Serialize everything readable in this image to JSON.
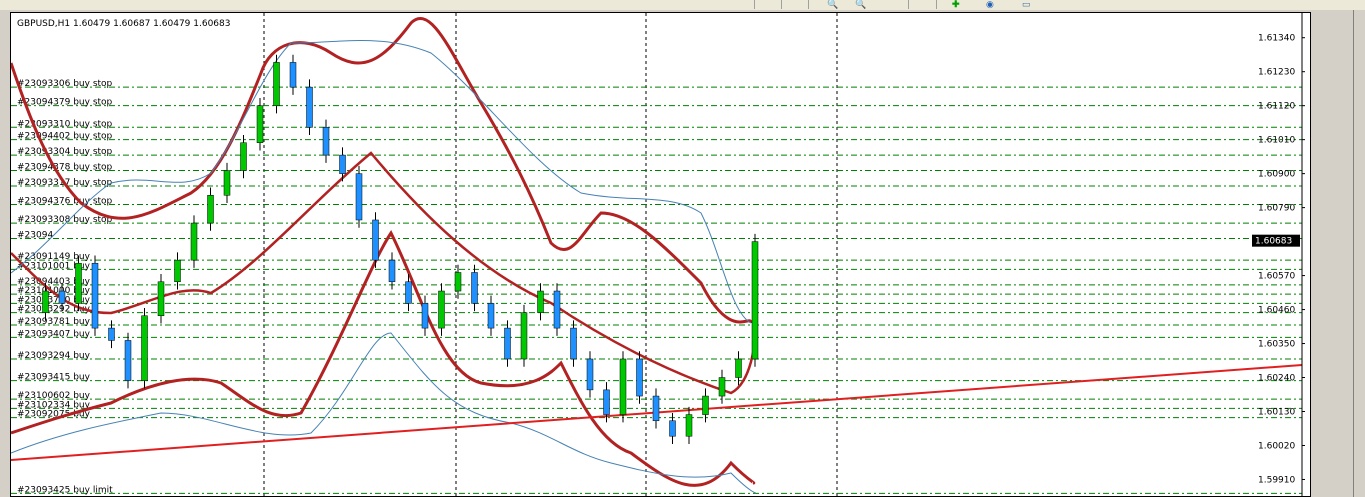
{
  "window": {
    "symbol_header": "GBPUSD,H1  1.60479 1.60687 1.60479 1.60683",
    "current_price": "1.60683"
  },
  "toolbar": {
    "icons": [
      "period-icon",
      "period-icon",
      "period-icon",
      "zoom-in-icon",
      "zoom-out-icon",
      "chart-shift-icon",
      "autoscroll-icon",
      "add-indicator-icon",
      "periodicity-icon",
      "template-icon"
    ]
  },
  "colors": {
    "buy": "#008000",
    "sell_bear": "#1e90ff",
    "band": "#b22222",
    "band_thin": "#4682b4",
    "trend": "#e02020",
    "grid": "#000000"
  },
  "price_axis": {
    "min": 1.5985,
    "max": 1.6142,
    "ticks": [
      "1.61340",
      "1.61230",
      "1.61120",
      "1.61010",
      "1.60900",
      "1.60790",
      "1.60570",
      "1.60460",
      "1.60350",
      "1.60240",
      "1.60130",
      "1.60020",
      "1.59910"
    ]
  },
  "orders": [
    {
      "label": "#23093306 buy stop",
      "price": 1.6118
    },
    {
      "label": "#23094379 buy stop",
      "price": 1.6112
    },
    {
      "label": "#23093310 buy stop",
      "price": 1.6105
    },
    {
      "label": "#23094402 buy stop",
      "price": 1.6101
    },
    {
      "label": "#23093304 buy stop",
      "price": 1.6096
    },
    {
      "label": "#23094378 buy stop",
      "price": 1.6091
    },
    {
      "label": "#23093317 buy stop",
      "price": 1.6086
    },
    {
      "label": "#23094376 buy stop",
      "price": 1.608
    },
    {
      "label": "#23093308 buy stop",
      "price": 1.6074
    },
    {
      "label": "#23094",
      "price": 1.6069
    },
    {
      "label": "#23091149 buy",
      "price": 1.6062
    },
    {
      "label": "#23101001 buy",
      "price": 1.6059
    },
    {
      "label": "#23094403 buy",
      "price": 1.6054
    },
    {
      "label": "#23101000 buy",
      "price": 1.6051
    },
    {
      "label": "#23093770 buy",
      "price": 1.6048
    },
    {
      "label": "#23093292 buy",
      "price": 1.6045
    },
    {
      "label": "#23093781 buy",
      "price": 1.6041
    },
    {
      "label": "#23093407 buy",
      "price": 1.6037
    },
    {
      "label": "#23093294 buy",
      "price": 1.603
    },
    {
      "label": "#23093415 buy",
      "price": 1.6023
    },
    {
      "label": "#23100602 buy",
      "price": 1.6017
    },
    {
      "label": "#23102334 buy",
      "price": 1.6014
    },
    {
      "label": "#23092075 buy",
      "price": 1.6011
    },
    {
      "label": "#23093425 buy limit",
      "price": 1.59865
    }
  ]
}
